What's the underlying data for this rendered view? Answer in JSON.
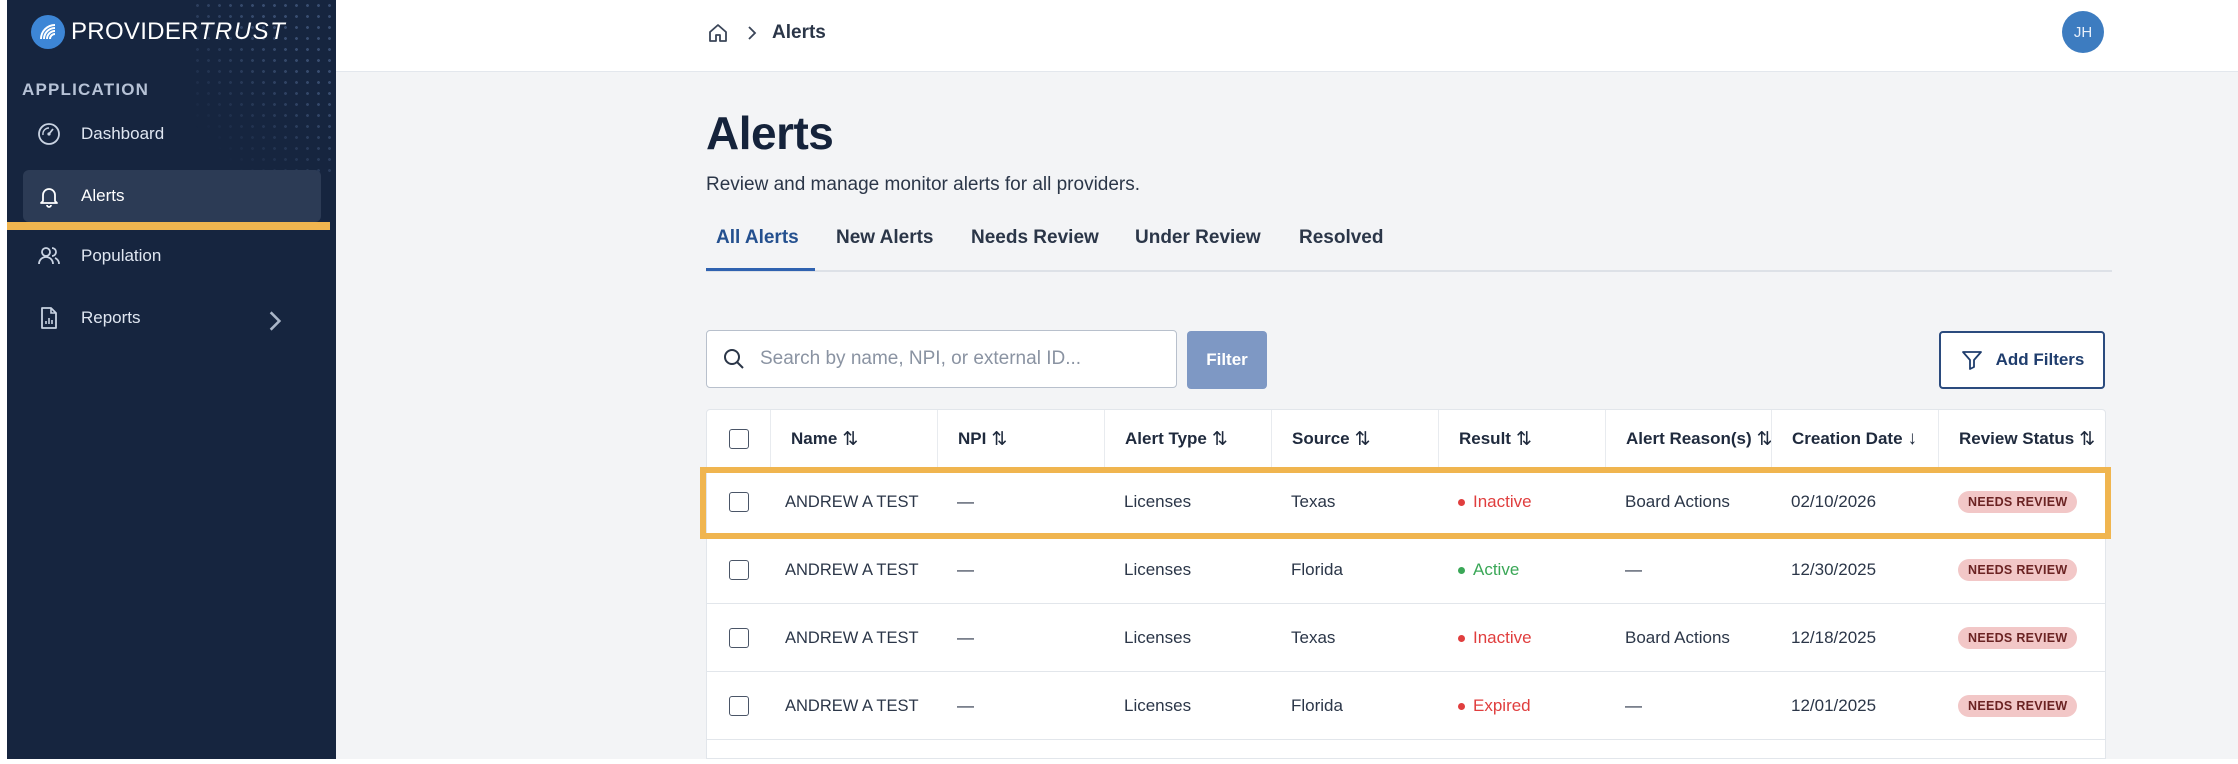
{
  "app": {
    "logo_part1": "PROVIDER",
    "logo_part2": "TRUST",
    "section_label": "APPLICATION"
  },
  "sidebar": {
    "items": [
      {
        "label": "Dashboard",
        "icon": "gauge-icon"
      },
      {
        "label": "Alerts",
        "icon": "bell-icon",
        "active": true
      },
      {
        "label": "Population",
        "icon": "users-icon"
      },
      {
        "label": "Reports",
        "icon": "report-icon",
        "has_submenu": true
      }
    ]
  },
  "header": {
    "breadcrumb_current": "Alerts",
    "avatar_initials": "JH"
  },
  "page": {
    "title": "Alerts",
    "subtitle": "Review and manage monitor alerts for all providers."
  },
  "tabs": [
    {
      "label": "All Alerts",
      "active": true
    },
    {
      "label": "New Alerts"
    },
    {
      "label": "Needs Review"
    },
    {
      "label": "Under Review"
    },
    {
      "label": "Resolved"
    }
  ],
  "toolbar": {
    "search_placeholder": "Search by name, NPI, or external ID...",
    "filter_label": "Filter",
    "add_filters_label": "Add Filters"
  },
  "table": {
    "columns": [
      {
        "label": "Name",
        "sort": "⇅"
      },
      {
        "label": "NPI",
        "sort": "⇅"
      },
      {
        "label": "Alert Type",
        "sort": "⇅"
      },
      {
        "label": "Source",
        "sort": "⇅"
      },
      {
        "label": "Result",
        "sort": "⇅"
      },
      {
        "label": "Alert Reason(s)",
        "sort": "⇅"
      },
      {
        "label": "Creation Date",
        "sort": "↓"
      },
      {
        "label": "Review Status",
        "sort": "⇅"
      }
    ],
    "rows": [
      {
        "name": "ANDREW A TEST",
        "npi": "—",
        "alert_type": "Licenses",
        "source": "Texas",
        "result": "Inactive",
        "reason": "Board Actions",
        "date": "02/10/2026",
        "status": "NEEDS REVIEW"
      },
      {
        "name": "ANDREW A TEST",
        "npi": "—",
        "alert_type": "Licenses",
        "source": "Florida",
        "result": "Active",
        "reason": "—",
        "date": "12/30/2025",
        "status": "NEEDS REVIEW"
      },
      {
        "name": "ANDREW A TEST",
        "npi": "—",
        "alert_type": "Licenses",
        "source": "Texas",
        "result": "Inactive",
        "reason": "Board Actions",
        "date": "12/18/2025",
        "status": "NEEDS REVIEW"
      },
      {
        "name": "ANDREW A TEST",
        "npi": "—",
        "alert_type": "Licenses",
        "source": "Florida",
        "result": "Expired",
        "reason": "—",
        "date": "12/01/2025",
        "status": "NEEDS REVIEW"
      }
    ]
  },
  "colors": {
    "sidebar_bg": "#16253f",
    "accent_blue": "#2f62b0",
    "highlight": "#f0b54f",
    "result_inactive": "#e03e3e",
    "result_active": "#3aa757",
    "result_expired": "#e03e3e"
  }
}
